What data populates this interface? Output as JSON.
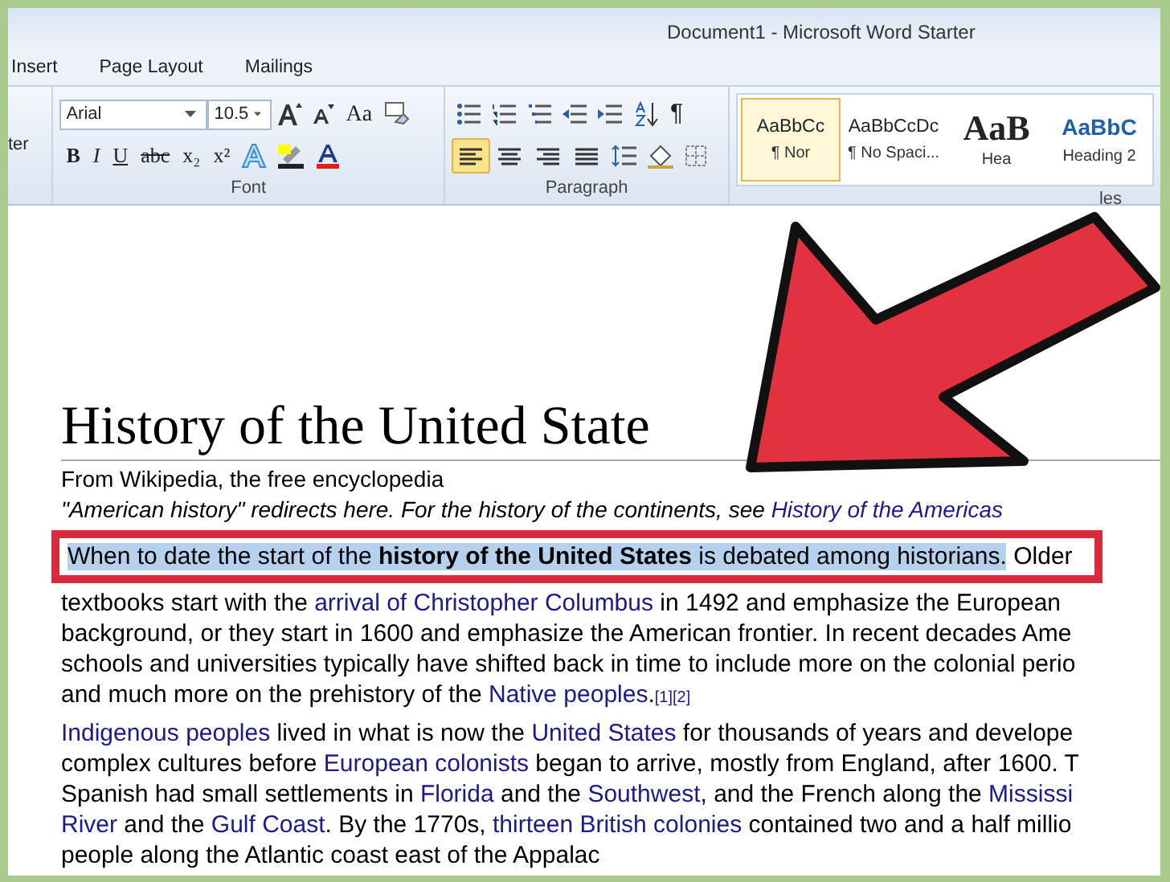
{
  "window": {
    "title": "Document1  -  Microsoft Word Starter"
  },
  "ribbon_tabs": [
    "Insert",
    "Page Layout",
    "Mailings"
  ],
  "ribbon": {
    "clipboard": {
      "label": "ter"
    },
    "font": {
      "name": "Arial",
      "size": "10.5",
      "case_button": "Aa",
      "format_buttons": [
        "B",
        "I",
        "U",
        "abc",
        "x₂",
        "x²"
      ],
      "label": "Font"
    },
    "paragraph": {
      "label": "Paragraph",
      "marks_button": "¶",
      "alignment_buttons": [
        {
          "selected": true
        },
        {
          "selected": false
        },
        {
          "selected": false
        },
        {
          "selected": false
        }
      ]
    },
    "styles": {
      "label": "les",
      "items": [
        {
          "sample": "AaBbCc",
          "label": "¶ Nor",
          "kind": "body",
          "selected": true
        },
        {
          "sample": "AaBbCcDc",
          "label": "¶ No Spaci...",
          "kind": "body",
          "selected": false
        },
        {
          "sample": "AaB",
          "label": "Hea",
          "kind": "heading1",
          "selected": false
        },
        {
          "sample": "AaBbC",
          "label": "Heading 2",
          "kind": "heading2",
          "selected": false
        }
      ]
    }
  },
  "document": {
    "title": "History of the United State",
    "subtitle": "From Wikipedia, the free encyclopedia",
    "hatnote": [
      {
        "t": "\"American history\" redirects here. For the history of the continents, see ",
        "kind": "italic"
      },
      {
        "t": "History of the Americas",
        "kind": "italic-link"
      }
    ],
    "paragraphs": [
      {
        "lines": [
          [
            {
              "t": "When to date the start of the ",
              "kind": "sel"
            },
            {
              "t": "history of the United States",
              "kind": "sel-bold"
            },
            {
              "t": " is debated among historians.",
              "kind": "sel"
            },
            {
              "t": " Older",
              "kind": "text"
            }
          ],
          [
            {
              "t": "textbooks start with the ",
              "kind": "text"
            },
            {
              "t": "arrival of Christopher Columbus",
              "kind": "link"
            },
            {
              "t": " in 1492 and emphasize the European",
              "kind": "text"
            }
          ],
          [
            {
              "t": "background, or they start in 1600 and emphasize the American frontier. In recent decades Ame",
              "kind": "text"
            }
          ],
          [
            {
              "t": "schools and universities typically have shifted back in time to include more on the colonial perio",
              "kind": "text"
            }
          ],
          [
            {
              "t": "and much more on the prehistory of the ",
              "kind": "text"
            },
            {
              "t": "Native peoples",
              "kind": "link"
            },
            {
              "t": ".",
              "kind": "text"
            },
            {
              "t": "[1][2]",
              "kind": "ref"
            }
          ]
        ]
      },
      {
        "lines": [
          [
            {
              "t": "Indigenous peoples",
              "kind": "link"
            },
            {
              "t": " lived in what is now the ",
              "kind": "text"
            },
            {
              "t": "United States",
              "kind": "link"
            },
            {
              "t": " for thousands of years and develope",
              "kind": "text"
            }
          ],
          [
            {
              "t": "complex cultures before ",
              "kind": "text"
            },
            {
              "t": "European colonists",
              "kind": "link"
            },
            {
              "t": " began to arrive, mostly from England, after 1600. T",
              "kind": "text"
            }
          ],
          [
            {
              "t": "Spanish had small settlements in ",
              "kind": "text"
            },
            {
              "t": "Florida",
              "kind": "link"
            },
            {
              "t": " and the ",
              "kind": "text"
            },
            {
              "t": "Southwest",
              "kind": "link"
            },
            {
              "t": ", and the French along the ",
              "kind": "text"
            },
            {
              "t": "Mississi",
              "kind": "link"
            }
          ],
          [
            {
              "t": "River",
              "kind": "link"
            },
            {
              "t": " and the ",
              "kind": "text"
            },
            {
              "t": "Gulf Coast",
              "kind": "link"
            },
            {
              "t": ". By the 1770s, ",
              "kind": "text"
            },
            {
              "t": "thirteen British colonies",
              "kind": "link"
            },
            {
              "t": " contained two and a half millio",
              "kind": "text"
            }
          ],
          [
            {
              "t": "people along the Atlantic coast east of the Appalac",
              "kind": "text"
            }
          ]
        ]
      }
    ]
  }
}
